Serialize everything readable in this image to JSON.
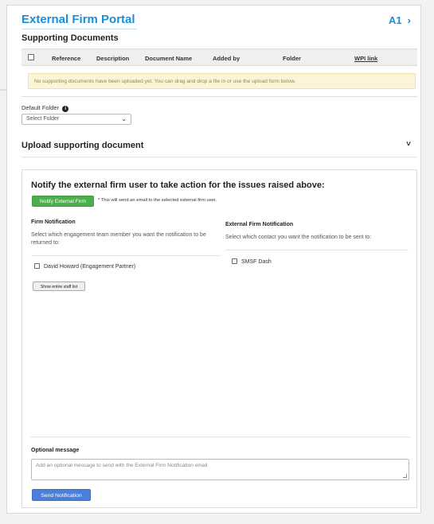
{
  "header": {
    "title": "External Firm Portal",
    "id_label": "A1",
    "chevron": "›"
  },
  "supporting_docs": {
    "title": "Supporting Documents",
    "columns": [
      "Reference",
      "Description",
      "Document Name",
      "Added by",
      "Folder",
      "WPI link"
    ],
    "empty_message": "No supporting documents have been uploaded yet. You can drag and drop a file in or use the upload form below."
  },
  "default_folder": {
    "label": "Default Folder",
    "info_icon": "info-icon",
    "select_value": "Select Folder",
    "chevron": "⌄"
  },
  "upload": {
    "title": "Upload supporting document",
    "chevron": "˅"
  },
  "notify": {
    "heading": "Notify the external firm user to take action for the issues raised above:",
    "button_label": "Notify External Firm",
    "hint": "* This will send an email to the selected external firm user.",
    "firm": {
      "title": "Firm Notification",
      "desc": "Select which engagement team member you want the notification to be returned to:",
      "members": [
        "David Howard (Engagement Partner)"
      ],
      "staff_button": "Show entire staff list"
    },
    "external": {
      "title": "External Firm Notification",
      "desc": "Select which contact you want the notification to be sent to:",
      "contacts": [
        "SMSF Dash"
      ]
    },
    "message": {
      "label": "Optional message",
      "placeholder": "Add an optional message to send with the External Firm Notification email"
    },
    "send_label": "Send Notification"
  },
  "colors": {
    "accent_blue": "#1a8fd6",
    "notify_green": "#4cae4c",
    "send_blue": "#4a7fdc",
    "warning_bg": "#fcf4d8"
  }
}
